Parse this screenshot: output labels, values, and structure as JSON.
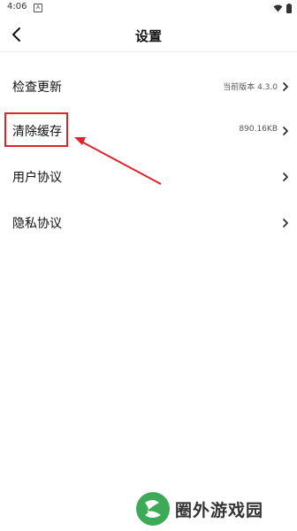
{
  "status_bar": {
    "time": "4:06",
    "notification_letter": "A"
  },
  "header": {
    "title": "设置"
  },
  "settings": [
    {
      "label": "检查更新",
      "value": "当前版本 4.3.0"
    },
    {
      "label": "清除缓存",
      "value": "890.16KB"
    },
    {
      "label": "用户协议",
      "value": ""
    },
    {
      "label": "隐私协议",
      "value": ""
    }
  ],
  "annotation": {
    "color": "#e1232b"
  },
  "watermark": {
    "text": "圈外游戏园",
    "color": "#3daa57"
  },
  "icons": {
    "back": "chevron-left-icon",
    "row_chevron": "chevron-right-icon",
    "wifi": "wifi-icon",
    "battery": "battery-icon"
  }
}
